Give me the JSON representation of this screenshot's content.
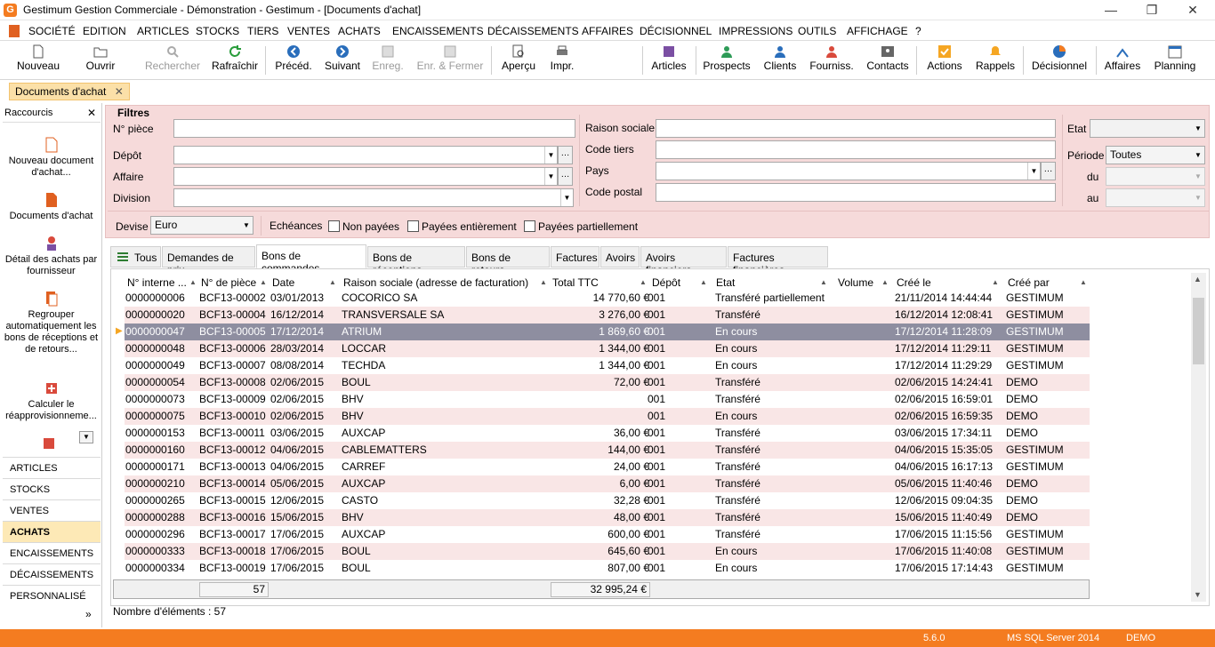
{
  "window": {
    "title": "Gestimum Gestion Commerciale - Démonstration - Gestimum - [Documents d'achat]",
    "logo": "G",
    "controls": [
      "—",
      "❐",
      "✕"
    ]
  },
  "menu": [
    "SOCIÉTÉ",
    "EDITION",
    "ARTICLES",
    "STOCKS",
    "TIERS",
    "VENTES",
    "ACHATS",
    "ENCAISSEMENTS",
    "DÉCAISSEMENTS",
    "AFFAIRES",
    "DÉCISIONNEL",
    "IMPRESSIONS",
    "OUTILS",
    "AFFICHAGE",
    "?"
  ],
  "toolbar": {
    "nouveau": "Nouveau",
    "ouvrir": "Ouvrir",
    "rechercher": "Rechercher",
    "rafraichir": "Rafraîchir",
    "preced": "Précéd.",
    "suivant": "Suivant",
    "enreg": "Enreg.",
    "enreg_fermer": "Enr. & Fermer",
    "apercu": "Aperçu",
    "impr": "Impr.",
    "articles": "Articles",
    "prospects": "Prospects",
    "clients": "Clients",
    "fourniss": "Fourniss.",
    "contacts": "Contacts",
    "actions": "Actions",
    "rappels": "Rappels",
    "decisionnel": "Décisionnel",
    "affaires": "Affaires",
    "planning": "Planning"
  },
  "doc_tab": {
    "label": "Documents d'achat",
    "close": "✕"
  },
  "sidebar": {
    "title": "Raccourcis",
    "close": "✕",
    "shortcuts": [
      "Nouveau document d'achat...",
      "Documents d'achat",
      "Détail des achats par fournisseur",
      "Regrouper automatiquement les bons de réceptions et de retours...",
      "Calculer le réapprovisionneme..."
    ],
    "nav": [
      "ARTICLES",
      "STOCKS",
      "VENTES",
      "ACHATS",
      "ENCAISSEMENTS",
      "DÉCAISSEMENTS",
      "PERSONNALISÉ"
    ],
    "active_nav": "ACHATS",
    "more": "»"
  },
  "filters": {
    "legend": "Filtres",
    "npiece": "N° pièce",
    "depot": "Dépôt",
    "affaire": "Affaire",
    "division": "Division",
    "raison_sociale": "Raison sociale",
    "code_tiers": "Code tiers",
    "pays": "Pays",
    "code_postal": "Code postal",
    "etat": "Etat",
    "periode": "Période",
    "periode_value": "Toutes",
    "du": "du",
    "au": "au",
    "devise": "Devise",
    "devise_value": "Euro",
    "echeances": "Echéances",
    "non_payees": "Non payées",
    "payees_entierement": "Payées entièrement",
    "payees_partiellement": "Payées partiellement"
  },
  "tabs": [
    "Tous",
    "Demandes de prix",
    "Bons de commandes",
    "Bons de réceptions",
    "Bons de retours",
    "Factures",
    "Avoirs",
    "Avoirs financiers",
    "Factures financières"
  ],
  "active_tab": "Bons de commandes",
  "grid": {
    "headers": [
      "N° interne ...",
      "N° de pièce",
      "Date",
      "Raison sociale (adresse de facturation)",
      "Total TTC",
      "Dépôt",
      "Etat",
      "Volume",
      "Créé le",
      "Créé par"
    ],
    "rows": [
      [
        "0000000006",
        "BCF13-00002",
        "03/01/2013",
        "COCORICO SA",
        "14 770,60 €",
        "001",
        "Transféré partiellement",
        "",
        "21/11/2014 14:44:44",
        "GESTIMUM"
      ],
      [
        "0000000020",
        "BCF13-00004",
        "16/12/2014",
        "TRANSVERSALE SA",
        "3 276,00 €",
        "001",
        "Transféré",
        "",
        "16/12/2014 12:08:41",
        "GESTIMUM"
      ],
      [
        "0000000047",
        "BCF13-00005",
        "17/12/2014",
        "ATRIUM",
        "1 869,60 €",
        "001",
        "En cours",
        "",
        "17/12/2014 11:28:09",
        "GESTIMUM"
      ],
      [
        "0000000048",
        "BCF13-00006",
        "28/03/2014",
        "LOCCAR",
        "1 344,00 €",
        "001",
        "En cours",
        "",
        "17/12/2014 11:29:11",
        "GESTIMUM"
      ],
      [
        "0000000049",
        "BCF13-00007",
        "08/08/2014",
        "TECHDA",
        "1 344,00 €",
        "001",
        "En cours",
        "",
        "17/12/2014 11:29:29",
        "GESTIMUM"
      ],
      [
        "0000000054",
        "BCF13-00008",
        "02/06/2015",
        "BOUL",
        "72,00 €",
        "001",
        "Transféré",
        "",
        "02/06/2015 14:24:41",
        "DEMO"
      ],
      [
        "0000000073",
        "BCF13-00009",
        "02/06/2015",
        "BHV",
        "",
        "001",
        "Transféré",
        "",
        "02/06/2015 16:59:01",
        "DEMO"
      ],
      [
        "0000000075",
        "BCF13-00010",
        "02/06/2015",
        "BHV",
        "",
        "001",
        "En cours",
        "",
        "02/06/2015 16:59:35",
        "DEMO"
      ],
      [
        "0000000153",
        "BCF13-00011",
        "03/06/2015",
        "AUXCAP",
        "36,00 €",
        "001",
        "Transféré",
        "",
        "03/06/2015 17:34:11",
        "DEMO"
      ],
      [
        "0000000160",
        "BCF13-00012",
        "04/06/2015",
        "CABLEMATTERS",
        "144,00 €",
        "001",
        "Transféré",
        "",
        "04/06/2015 15:35:05",
        "GESTIMUM"
      ],
      [
        "0000000171",
        "BCF13-00013",
        "04/06/2015",
        "CARREF",
        "24,00 €",
        "001",
        "Transféré",
        "",
        "04/06/2015 16:17:13",
        "GESTIMUM"
      ],
      [
        "0000000210",
        "BCF13-00014",
        "05/06/2015",
        "AUXCAP",
        "6,00 €",
        "001",
        "Transféré",
        "",
        "05/06/2015 11:40:46",
        "DEMO"
      ],
      [
        "0000000265",
        "BCF13-00015",
        "12/06/2015",
        "CASTO",
        "32,28 €",
        "001",
        "Transféré",
        "",
        "12/06/2015 09:04:35",
        "DEMO"
      ],
      [
        "0000000288",
        "BCF13-00016",
        "15/06/2015",
        "BHV",
        "48,00 €",
        "001",
        "Transféré",
        "",
        "15/06/2015 11:40:49",
        "DEMO"
      ],
      [
        "0000000296",
        "BCF13-00017",
        "17/06/2015",
        "AUXCAP",
        "600,00 €",
        "001",
        "Transféré",
        "",
        "17/06/2015 11:15:56",
        "GESTIMUM"
      ],
      [
        "0000000333",
        "BCF13-00018",
        "17/06/2015",
        "BOUL",
        "645,60 €",
        "001",
        "En cours",
        "",
        "17/06/2015 11:40:08",
        "GESTIMUM"
      ],
      [
        "0000000334",
        "BCF13-00019",
        "17/06/2015",
        "BOUL",
        "807,00 €",
        "001",
        "En cours",
        "",
        "17/06/2015 17:14:43",
        "GESTIMUM"
      ]
    ],
    "selected_index": 2,
    "total_count": "57",
    "total_ttc": "32 995,24 €"
  },
  "footer": {
    "count": "Nombre d'éléments : 57"
  },
  "status": {
    "version": "5.6.0",
    "db": "MS SQL Server 2014",
    "user": "DEMO"
  },
  "colors": {
    "accent": "#f47c20",
    "filter_bg": "#f6dada",
    "row_alt": "#f9e6e6",
    "row_selected": "#8e8ea0"
  }
}
